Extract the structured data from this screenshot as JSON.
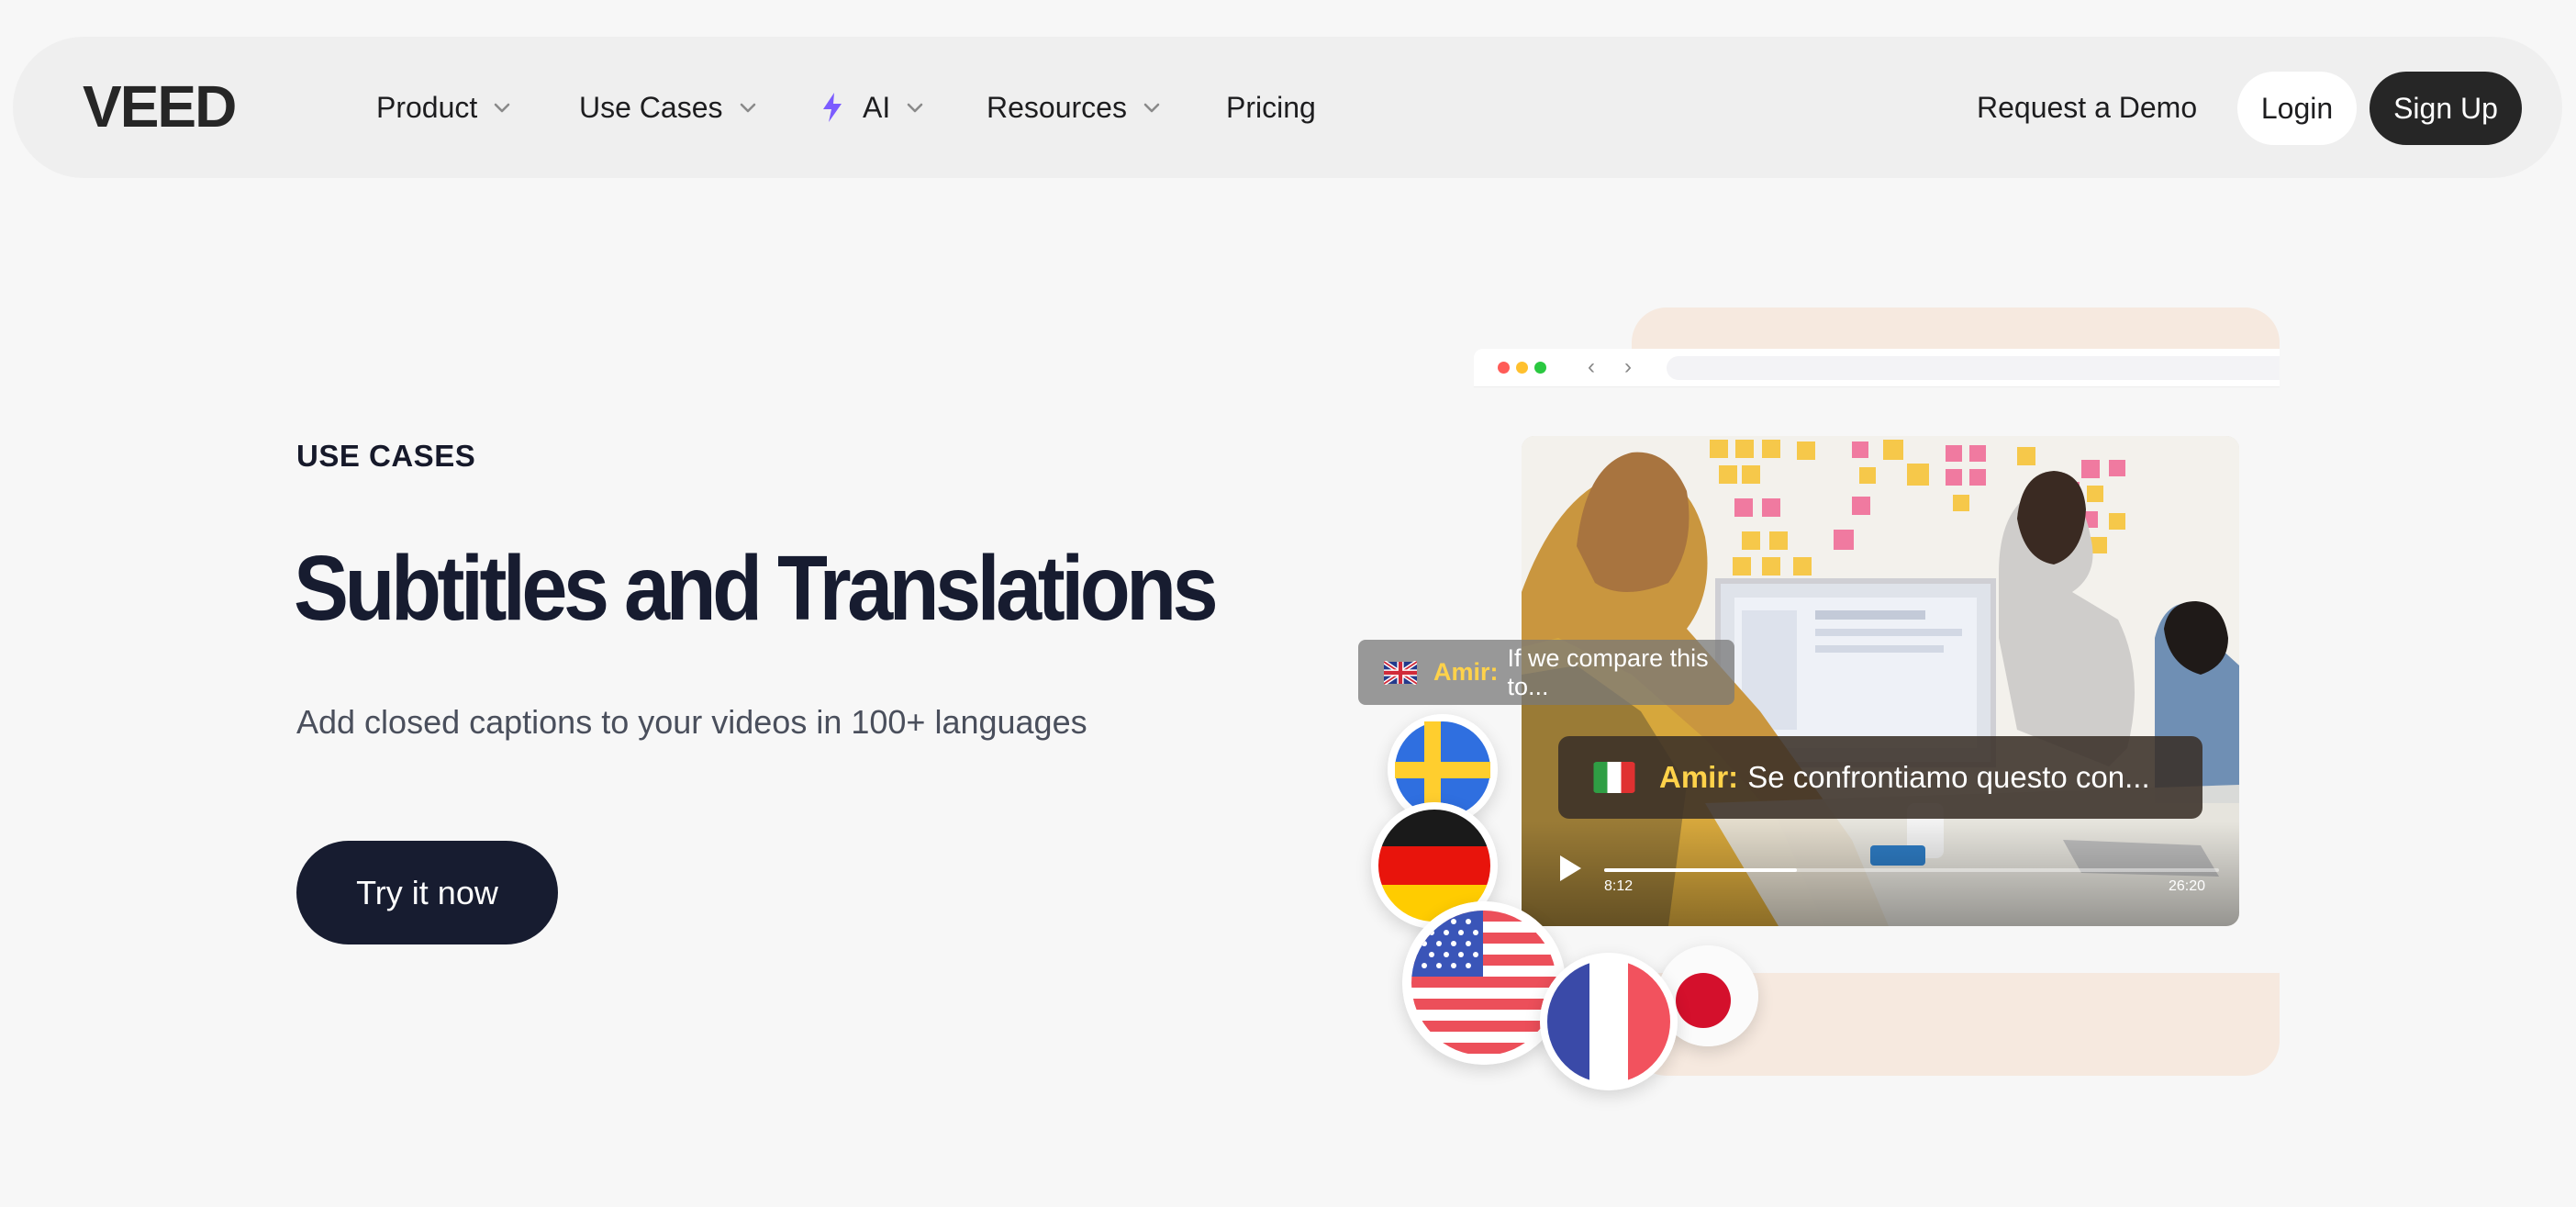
{
  "nav": {
    "logo_text": "VEED",
    "items": [
      {
        "label": "Product",
        "has_dropdown": true
      },
      {
        "label": "Use Cases",
        "has_dropdown": true
      },
      {
        "label": "AI",
        "has_dropdown": true,
        "icon": "lightning-icon"
      },
      {
        "label": "Resources",
        "has_dropdown": true
      },
      {
        "label": "Pricing",
        "has_dropdown": false
      }
    ],
    "request_demo": "Request a Demo",
    "login": "Login",
    "sign_up": "Sign Up"
  },
  "hero": {
    "eyebrow": "USE CASES",
    "title": "Subtitles and Translations",
    "subtitle": "Add closed captions to your videos in 100+ languages",
    "cta": "Try it now"
  },
  "preview": {
    "caption_en": {
      "speaker": "Amir:",
      "text": "If we compare this to..."
    },
    "caption_it": {
      "speaker": "Amir:",
      "text": "Se confrontiamo questo con..."
    },
    "time_current": "8:12",
    "time_total": "26:20",
    "flags": [
      "sweden-flag",
      "germany-flag",
      "usa-flag",
      "france-flag",
      "japan-flag",
      "uk-flag",
      "italy-flag"
    ]
  },
  "colors": {
    "brand_dark": "#171c30",
    "caption_speaker": "#ffd24a",
    "ai_accent": "#7b5cff",
    "peach_bg": "#f6e9df"
  }
}
